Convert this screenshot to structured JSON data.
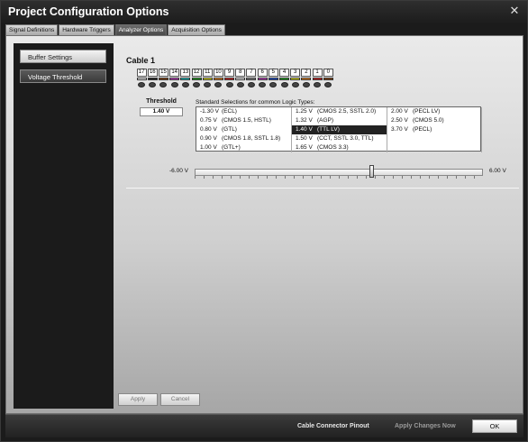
{
  "window": {
    "title": "Project Configuration Options",
    "close_icon": "✕"
  },
  "tabs": [
    {
      "label": "Signal Definitions",
      "active": false
    },
    {
      "label": "Hardware Triggers",
      "active": false
    },
    {
      "label": "Analyzer Options",
      "active": true
    },
    {
      "label": "Acquisition Options",
      "active": false
    }
  ],
  "sidebar": {
    "items": [
      {
        "label": "Buffer Settings"
      },
      {
        "label": "Voltage Threshold"
      }
    ]
  },
  "cable": {
    "title": "Cable 1",
    "pins": [
      {
        "num": "17",
        "color": "#ffffff"
      },
      {
        "num": "16",
        "color": "#222222"
      },
      {
        "num": "15",
        "color": "#8b4513"
      },
      {
        "num": "14",
        "color": "#cc44cc"
      },
      {
        "num": "13",
        "color": "#22cccc"
      },
      {
        "num": "12",
        "color": "#22aa22"
      },
      {
        "num": "11",
        "color": "#eeee22"
      },
      {
        "num": "10",
        "color": "#ee8822"
      },
      {
        "num": "9",
        "color": "#dd2222"
      },
      {
        "num": "8",
        "color": "#ffffff"
      },
      {
        "num": "7",
        "color": "#888888"
      },
      {
        "num": "6",
        "color": "#cc44cc"
      },
      {
        "num": "5",
        "color": "#2255dd"
      },
      {
        "num": "4",
        "color": "#22aa22"
      },
      {
        "num": "3",
        "color": "#eeee22"
      },
      {
        "num": "2",
        "color": "#ee8822"
      },
      {
        "num": "1",
        "color": "#dd2222"
      },
      {
        "num": "0",
        "color": "#8b4513"
      }
    ]
  },
  "threshold": {
    "label": "Threshold",
    "value": "1.40 V"
  },
  "standard": {
    "label": "Standard Selections for common Logic Types:",
    "options": [
      {
        "value": "-1.30 V",
        "name": "(ECL)",
        "selected": false
      },
      {
        "value": "0.75 V",
        "name": "(CMOS 1.5, HSTL)",
        "selected": false
      },
      {
        "value": "0.80 V",
        "name": "(GTL)",
        "selected": false
      },
      {
        "value": "0.90 V",
        "name": "(CMOS 1.8, SSTL 1.8)",
        "selected": false
      },
      {
        "value": "1.00 V",
        "name": "(GTL+)",
        "selected": false
      },
      {
        "value": "1.25 V",
        "name": "(CMOS 2.5, SSTL 2.0)",
        "selected": false
      },
      {
        "value": "1.32 V",
        "name": "(AGP)",
        "selected": false
      },
      {
        "value": "1.40 V",
        "name": "(TTL LV)",
        "selected": true
      },
      {
        "value": "1.50 V",
        "name": "(CCT, SSTL 3.0, TTL)",
        "selected": false
      },
      {
        "value": "1.65 V",
        "name": "(CMOS 3.3)",
        "selected": false
      },
      {
        "value": "2.00 V",
        "name": "(PECL LV)",
        "selected": false
      },
      {
        "value": "2.50 V",
        "name": "(CMOS 5.0)",
        "selected": false
      },
      {
        "value": "3.70 V",
        "name": "(PECL)",
        "selected": false
      }
    ]
  },
  "slider": {
    "min_label": "-6.00 V",
    "max_label": "6.00 V",
    "min": -6.0,
    "max": 6.0,
    "value": 1.4
  },
  "panel_buttons": {
    "apply": "Apply",
    "cancel": "Cancel"
  },
  "footer": {
    "pinout_link": "Cable Connector Pinout",
    "apply_now": "Apply Changes Now",
    "ok": "OK"
  }
}
